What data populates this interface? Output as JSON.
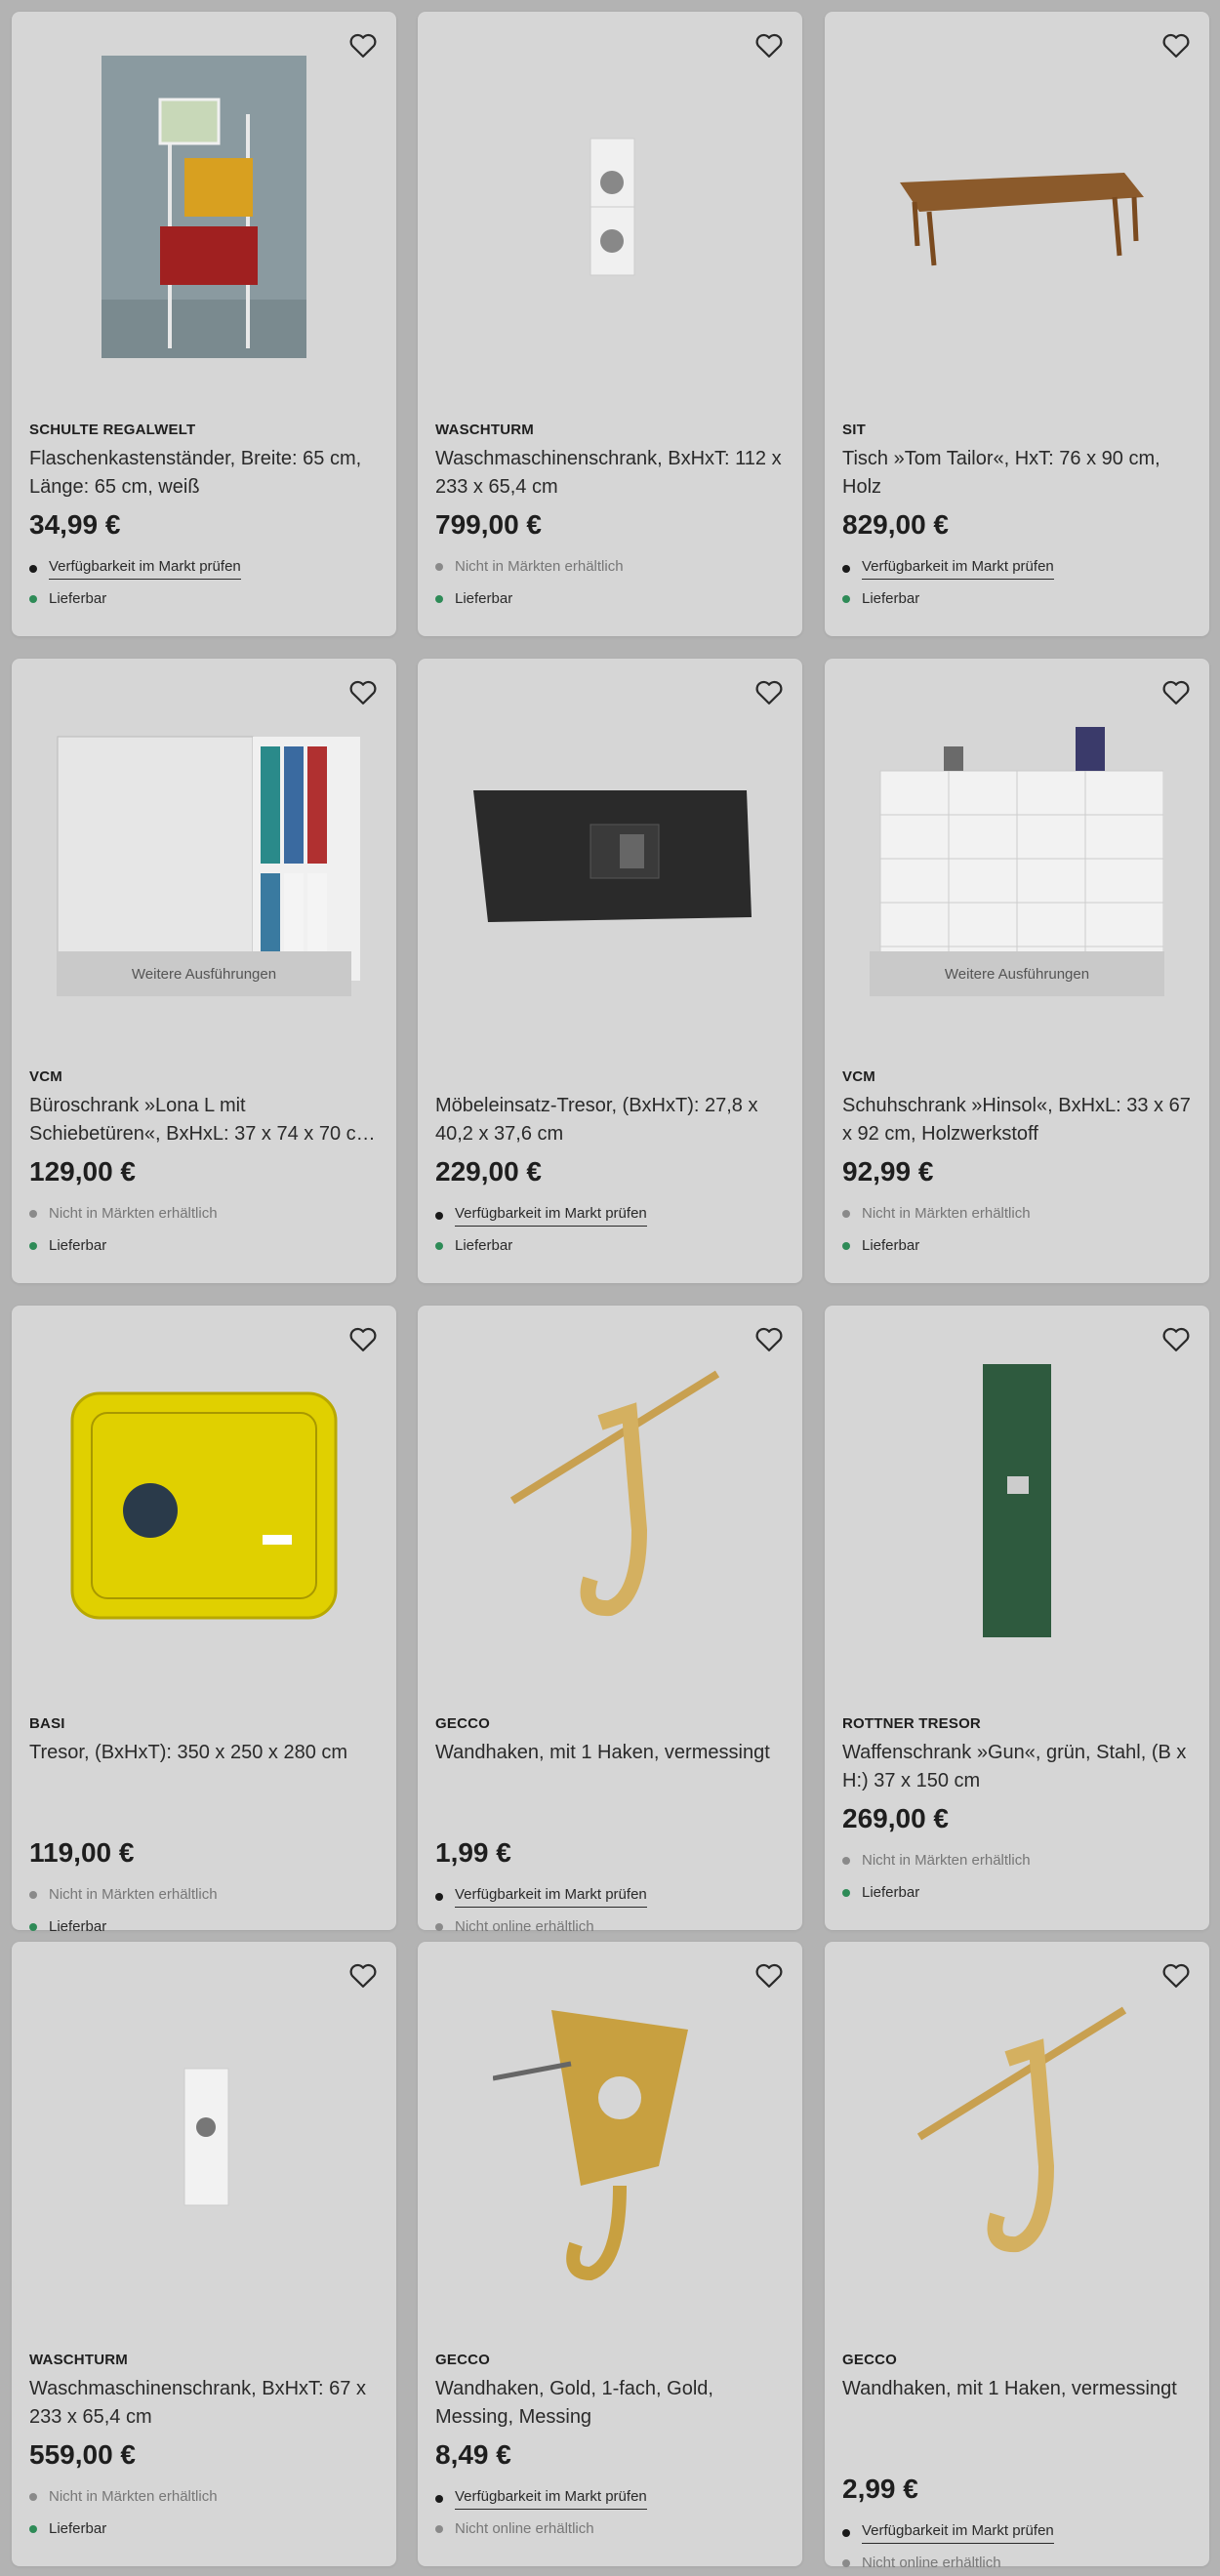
{
  "wishlist_icon": "heart-outline-icon",
  "more_variants_label": "Weitere Ausführungen",
  "colors": {
    "available": "#2e8b57",
    "unavailable": "#8a8a8a",
    "check": "#1a1a1a"
  },
  "products": [
    {
      "brand": "SCHULTE REGALWELT",
      "title": "Flaschenkastenständer, Breite: 65 cm, Länge: 65 cm, weiß",
      "price": "34,99 €",
      "store": "Verfügbarkeit im Markt prüfen",
      "online": "Lieferbar",
      "image": "crate-stand-image"
    },
    {
      "brand": "WASCHTURM",
      "title": "Waschmaschinenschrank, BxHxT: 112 x 233 x 65,4 cm",
      "price": "799,00 €",
      "store": "Nicht in Märkten erhältlich",
      "online": "Lieferbar",
      "image": "washer-tower-image"
    },
    {
      "brand": "SIT",
      "title": "Tisch »Tom Tailor«, HxT: 76 x 90 cm, Holz",
      "price": "829,00 €",
      "store": "Verfügbarkeit im Markt prüfen",
      "online": "Lieferbar",
      "image": "wooden-table-image"
    },
    {
      "brand": "VCM",
      "title": "Büroschrank »Lona L mit Schiebetüren«, BxHxL: 37 x 74 x 70 c…",
      "price": "129,00 €",
      "store": "Nicht in Märkten erhältlich",
      "online": "Lieferbar",
      "image": "office-cabinet-image",
      "more": true
    },
    {
      "brand": "",
      "title": "Möbeleinsatz-Tresor, (BxHxT): 27,8 x 40,2 x 37,6 cm",
      "price": "229,00 €",
      "store": "Verfügbarkeit im Markt prüfen",
      "online": "Lieferbar",
      "image": "safe-black-image"
    },
    {
      "brand": "VCM",
      "title": "Schuhschrank »Hinsol«, BxHxL: 33 x 67 x 92 cm, Holzwerkstoff",
      "price": "92,99 €",
      "store": "Nicht in Märkten erhältlich",
      "online": "Lieferbar",
      "image": "shoe-rack-image",
      "more": true
    },
    {
      "brand": "BASI",
      "title": "Tresor, (BxHxT): 350 x 250 x 280 cm",
      "price": "119,00 €",
      "store": "Nicht in Märkten erhältlich",
      "online": "Lieferbar",
      "image": "safe-yellow-image"
    },
    {
      "brand": "GECCO",
      "title": "Wandhaken, mit 1 Haken, vermessingt",
      "price": "1,99 €",
      "store": "Verfügbarkeit im Markt prüfen",
      "online": "Nicht online erhältlich",
      "image": "wall-hook-image"
    },
    {
      "brand": "ROTTNER TRESOR",
      "title": "Waffenschrank »Gun«, grün, Stahl, (B x H:) 37 x 150 cm",
      "price": "269,00 €",
      "store": "Nicht in Märkten erhältlich",
      "online": "Lieferbar",
      "image": "gun-cabinet-image"
    },
    {
      "brand": "WASCHTURM",
      "title": "Waschmaschinenschrank, BxHxT: 67 x 233 x 65,4 cm",
      "price": "559,00 €",
      "store": "Nicht in Märkten erhältlich",
      "online": "Lieferbar",
      "image": "washer-tower-small-image"
    },
    {
      "brand": "GECCO",
      "title": "Wandhaken, Gold, 1-fach, Gold, Messing, Messing",
      "price": "8,49 €",
      "store": "Verfügbarkeit im Markt prüfen",
      "online": "Nicht online erhältlich",
      "image": "gold-hook-plate-image"
    },
    {
      "brand": "GECCO",
      "title": "Wandhaken, mit 1 Haken, vermessingt",
      "price": "2,99 €",
      "store": "Verfügbarkeit im Markt prüfen",
      "online": "Nicht online erhältlich",
      "image": "wall-hook-image"
    }
  ]
}
